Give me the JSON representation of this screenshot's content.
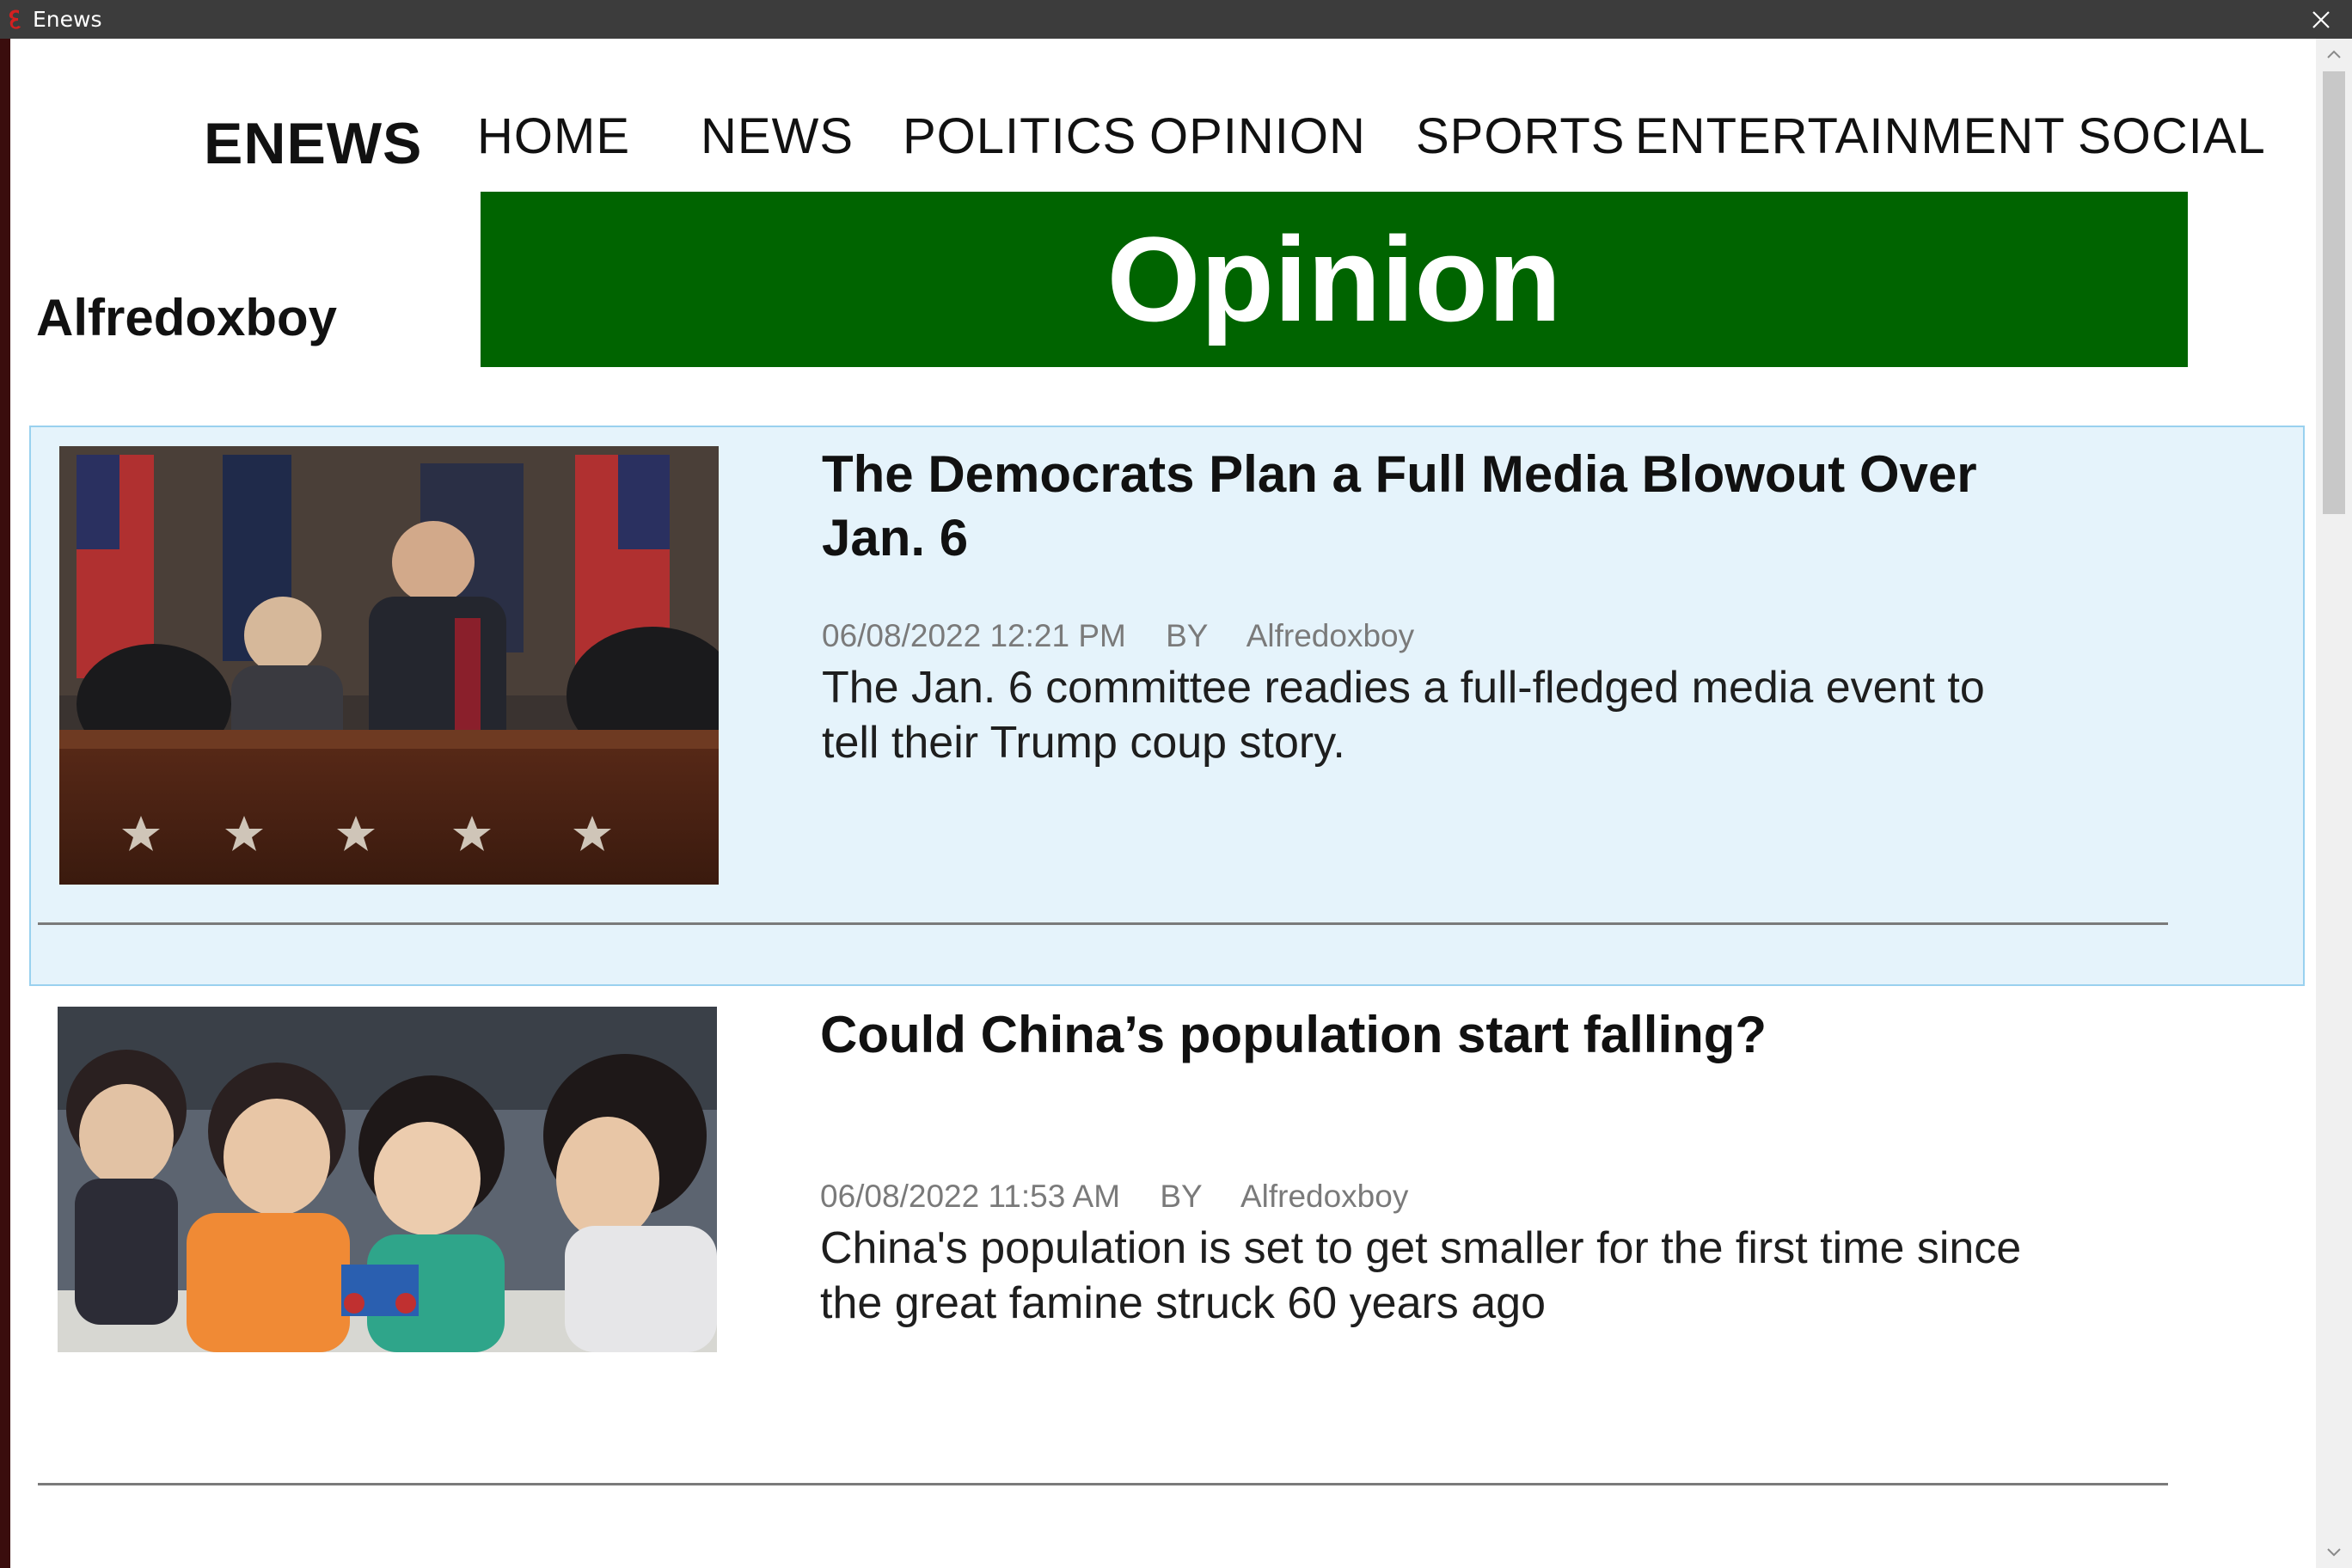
{
  "window": {
    "title": "Enews",
    "close_icon": "close-icon"
  },
  "header": {
    "logo": "ENEWS",
    "nav": [
      "HOME",
      "NEWS",
      "POLITICS",
      "OPINION",
      "SPORTS",
      "ENTERTAINMENT",
      "SOCIAL"
    ]
  },
  "user": {
    "name": "Alfredoxboy"
  },
  "banner": {
    "title": "Opinion",
    "color": "#006400"
  },
  "articles": [
    {
      "headline": "The Democrats Plan a Full Media Blowout Over Jan. 6",
      "date": "06/08/2022 12:21 PM",
      "by": "BY",
      "author": "Alfredoxboy",
      "summary": "The Jan. 6 committee readies a full-fledged media event to tell their Trump coup story.",
      "selected": true
    },
    {
      "headline": "Could China’s population start falling?",
      "date": "06/08/2022 11:53 AM",
      "by": "BY",
      "author": "Alfredoxboy",
      "summary": "China's population is set to get smaller for the first time since the great famine struck 60 years ago",
      "selected": false
    }
  ],
  "colors": {
    "accent_green": "#006400",
    "selection_bg": "#e5f3fb",
    "selection_border": "#99d1ef",
    "titlebar": "#3c3c3c"
  }
}
